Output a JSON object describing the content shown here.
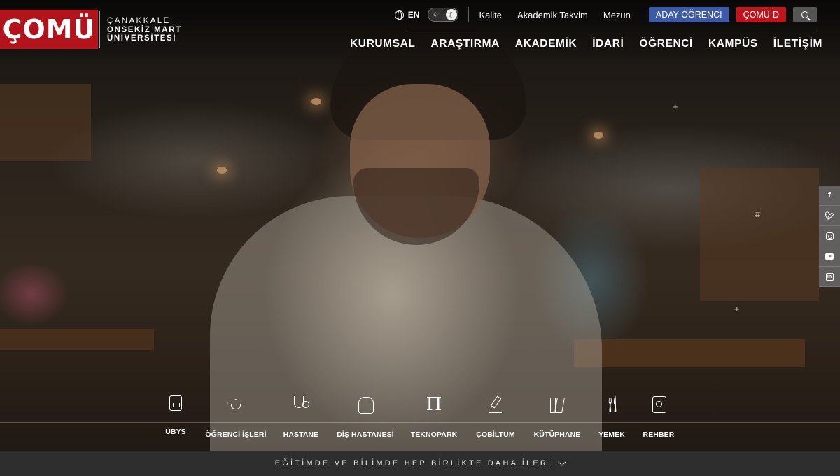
{
  "brand": {
    "logo": "ÇOMÜ",
    "line1": "ÇANAKKALE",
    "line2": "ONSEKİZ MART",
    "line3": "ÜNİVERSİTESİ",
    "color": "#b3141b"
  },
  "topbar": {
    "language": "EN",
    "links": [
      "Kalite",
      "Akademik Takvim",
      "Mezun"
    ],
    "aday_button": "ADAY ÖĞRENCİ",
    "comu_d_button": "ÇOMÜ-D",
    "search_icon": "search-icon",
    "theme_icons": [
      "sun-icon",
      "moon-icon"
    ]
  },
  "nav": [
    "KURUMSAL",
    "ARAŞTIRMA",
    "AKADEMİK",
    "İDARİ",
    "ÖĞRENCİ",
    "KAMPÜS",
    "İLETİŞİM"
  ],
  "social": [
    "facebook-icon",
    "twitter-icon",
    "instagram-icon",
    "youtube-icon",
    "linkedin-icon"
  ],
  "quick_links": [
    {
      "label": "ÜBYS",
      "icon": "document-chart-icon"
    },
    {
      "label": "ÖĞRENCİ İŞLERİ",
      "icon": "graduation-cap-icon"
    },
    {
      "label": "HASTANE",
      "icon": "stethoscope-icon"
    },
    {
      "label": "DİŞ HASTANESİ",
      "icon": "tooth-icon"
    },
    {
      "label": "TEKNOPARK",
      "icon": "pi-icon"
    },
    {
      "label": "ÇOBİLTUM",
      "icon": "microscope-icon"
    },
    {
      "label": "KÜTÜPHANE",
      "icon": "books-icon"
    },
    {
      "label": "YEMEK",
      "icon": "fork-knife-icon"
    },
    {
      "label": "REHBER",
      "icon": "contacts-book-icon"
    }
  ],
  "slogan": "EĞİTİMDE VE BİLİMDE HEP BİRLİKTE DAHA İLERİ",
  "colors": {
    "blue_button": "#3c5aa8",
    "red_button": "#c0141c",
    "slogan_bar": "#2e2e2e"
  }
}
